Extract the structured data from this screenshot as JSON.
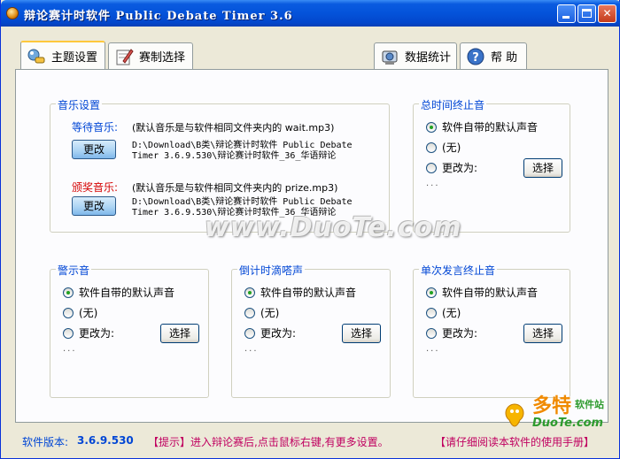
{
  "window": {
    "title": "辩论赛计时软件 Public Debate Timer 3.6"
  },
  "tabs": [
    {
      "label": "主题设置",
      "icon": "theme-icon"
    },
    {
      "label": "赛制选择",
      "icon": "format-icon"
    },
    {
      "label": "数据统计",
      "icon": "stats-icon"
    },
    {
      "label": "帮 助",
      "icon": "help-icon"
    }
  ],
  "music": {
    "title": "音乐设置",
    "waiting_label": "等待音乐:",
    "waiting_desc": "(默认音乐是与软件相同文件夹内的 wait.mp3)",
    "waiting_path": "D:\\Download\\B类\\辩论赛计时软件 Public Debate\nTimer 3.6.9.530\\辩论赛计时软件_36_华语辩论",
    "award_label": "颁奖音乐:",
    "award_desc": "(默认音乐是与软件相同文件夹内的 prize.mp3)",
    "award_path": "D:\\Download\\B类\\辩论赛计时软件 Public Debate\nTimer 3.6.9.530\\辩论赛计时软件_36_华语辩论",
    "change_label": "更改"
  },
  "sound_groups": [
    {
      "title": "总时间终止音"
    },
    {
      "title": "警示音"
    },
    {
      "title": "倒计时滴嗒声"
    },
    {
      "title": "单次发言终止音"
    }
  ],
  "sound_options": {
    "default": "软件自带的默认声音",
    "none": "(无)",
    "change_to": "更改为:",
    "choose": "选择",
    "ellipsis": "..."
  },
  "watermark": "www.DuoTe.com",
  "status": {
    "version_label": "软件版本:",
    "version_value": "3.6.9.530",
    "tip": "【提示】进入辩论赛后,点击鼠标右键,有更多设置。",
    "manual": "【请仔细阅读本软件的使用手册】"
  },
  "logo": {
    "brand": "多特",
    "sub": "软件站",
    "site": "DuoTe.com"
  },
  "colors": {
    "accent": "#0046D5",
    "red": "#D40000",
    "titlebar": "#0453DA"
  }
}
